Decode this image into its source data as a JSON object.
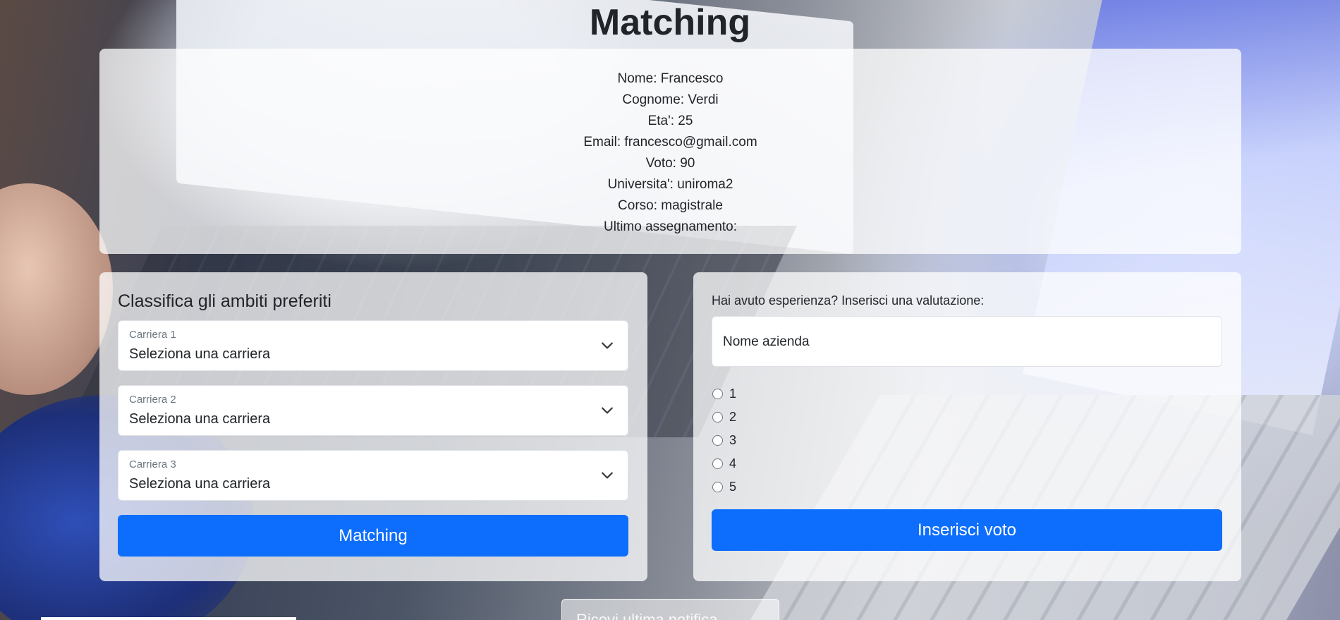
{
  "header": {
    "title": "Matching"
  },
  "profile": {
    "lines": [
      "Nome: Francesco",
      "Cognome: Verdi",
      "Eta': 25",
      "Email: francesco@gmail.com",
      "Voto: 90",
      "Universita': uniroma2",
      "Corso: magistrale",
      "Ultimo assegnamento:"
    ]
  },
  "preferences": {
    "title": "Classifica gli ambiti preferiti",
    "selects": [
      {
        "label": "Carriera 1",
        "value": "Seleziona una carriera"
      },
      {
        "label": "Carriera 2",
        "value": "Seleziona una carriera"
      },
      {
        "label": "Carriera 3",
        "value": "Seleziona una carriera"
      }
    ],
    "button_label": "Matching"
  },
  "rating": {
    "prompt": "Hai avuto esperienza? Inserisci una valutazione:",
    "company_placeholder": "Nome azienda",
    "options": [
      "1",
      "2",
      "3",
      "4",
      "5"
    ],
    "button_label": "Inserisci voto"
  },
  "footer": {
    "partial_button_label": "Ricevi ultima notifica"
  },
  "colors": {
    "primary": "#0d6efd",
    "card_bg": "rgba(255,255,255,0.75)",
    "text": "#212529"
  },
  "icons": {
    "select_indicator": "chevron-down-icon"
  }
}
